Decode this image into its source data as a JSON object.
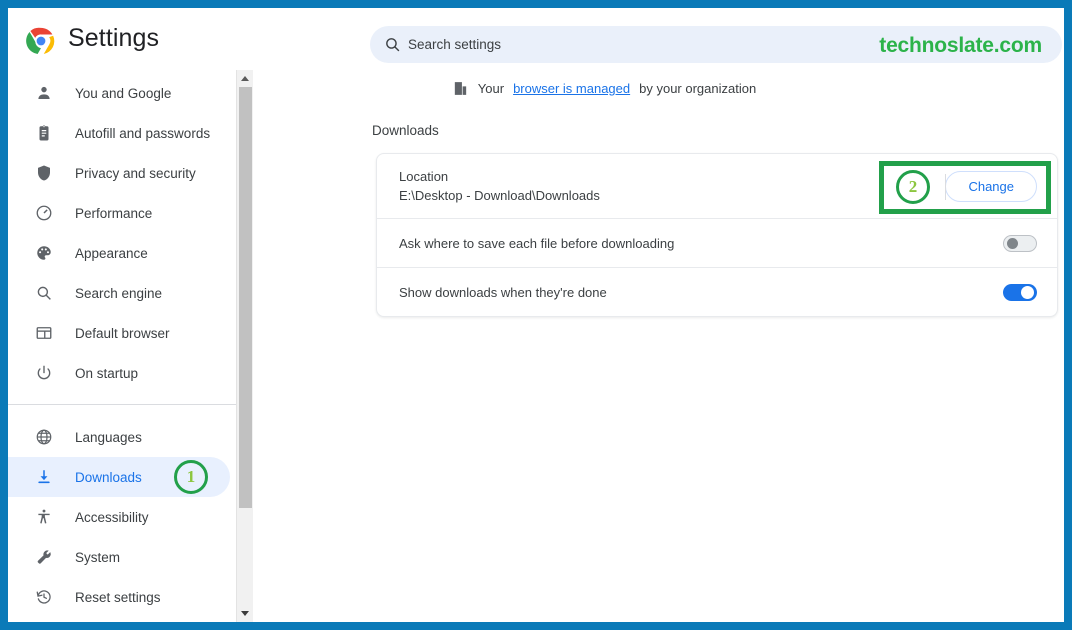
{
  "window": {
    "border_color": "#0a7ab8"
  },
  "header": {
    "title": "Settings",
    "logo_icon": "chrome-logo-icon",
    "watermark": "technoslate.com"
  },
  "search": {
    "placeholder": "Search settings",
    "value": "",
    "icon": "search-icon"
  },
  "managed_notice": {
    "icon": "building-icon",
    "prefix": "Your",
    "link": "browser is managed",
    "suffix": "by your organization"
  },
  "sidebar": {
    "group1": [
      {
        "label": "You and Google",
        "icon": "person-icon"
      },
      {
        "label": "Autofill and passwords",
        "icon": "clipboard-icon"
      },
      {
        "label": "Privacy and security",
        "icon": "shield-icon"
      },
      {
        "label": "Performance",
        "icon": "speedometer-icon"
      },
      {
        "label": "Appearance",
        "icon": "palette-icon"
      },
      {
        "label": "Search engine",
        "icon": "magnifier-icon"
      },
      {
        "label": "Default browser",
        "icon": "browser-window-icon"
      },
      {
        "label": "On startup",
        "icon": "power-icon"
      }
    ],
    "group2": [
      {
        "label": "Languages",
        "icon": "globe-icon"
      },
      {
        "label": "Downloads",
        "icon": "download-icon",
        "active": true
      },
      {
        "label": "Accessibility",
        "icon": "accessibility-icon"
      },
      {
        "label": "System",
        "icon": "wrench-icon"
      },
      {
        "label": "Reset settings",
        "icon": "history-restore-icon"
      }
    ]
  },
  "main": {
    "section_heading": "Downloads",
    "location_row": {
      "label": "Location",
      "path": "E:\\Desktop - Download\\Downloads",
      "button": "Change"
    },
    "ask_row": {
      "label": "Ask where to save each file before downloading",
      "toggle_state": "off"
    },
    "show_row": {
      "label": "Show downloads when they're done",
      "toggle_state": "on"
    }
  },
  "annotations": {
    "step1": "1",
    "step2": "2",
    "ring_color": "#22a04a",
    "number_color": "#8cc63f"
  }
}
